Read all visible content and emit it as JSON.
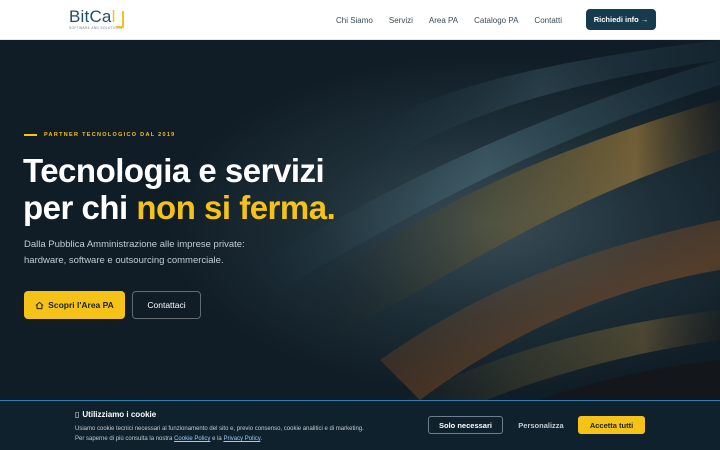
{
  "header": {
    "logo": {
      "word_main": "BitCa",
      "word_accent": "l",
      "tagline": "SOFTWARE AND SOLUTIONS"
    },
    "nav": [
      {
        "label": "Chi Siamo"
      },
      {
        "label": "Servizi"
      },
      {
        "label": "Area PA"
      },
      {
        "label": "Catalogo PA"
      },
      {
        "label": "Contatti"
      }
    ],
    "cta_label": "Richiedi info",
    "cta_arrow": "→"
  },
  "hero": {
    "eyebrow": "PARTNER TECNOLOGICO DAL 2019",
    "headline_line1": "Tecnologia e servizi",
    "headline_line2_plain": "per chi ",
    "headline_line2_highlight": "non si ferma.",
    "subtitle_line1": "Dalla Pubblica Amministrazione alle imprese private:",
    "subtitle_line2": "hardware, software e outsourcing commerciale.",
    "primary_button": "Scopri l'Area PA",
    "secondary_button": "Contattaci"
  },
  "cookie_banner": {
    "title": "Utilizziamo i cookie",
    "text_line1": "Usiamo cookie tecnici necessari al funzionamento del sito e, previo consenso, cookie analitici e di marketing.",
    "text_line2_prefix": "Per saperne di più consulta la nostra ",
    "cookie_policy_link": "Cookie Policy",
    "text_line2_mid": " e la ",
    "privacy_policy_link": "Privacy Policy",
    "text_line2_suffix": ".",
    "btn_necessary": "Solo necessari",
    "btn_customize": "Personalizza",
    "btn_accept": "Accetta tutti"
  },
  "colors": {
    "accent": "#f5c218",
    "brand_dark": "#173a4d",
    "hero_bg": "#101d26",
    "cookie_bg": "#0f212d"
  }
}
